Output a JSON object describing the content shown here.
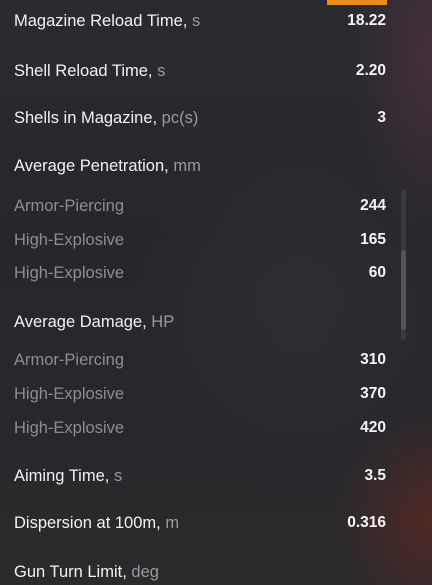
{
  "accent_color": "#ec8a1c",
  "stats": {
    "magazine_reload": {
      "label": "Magazine Reload Time,",
      "unit": "s",
      "value": "18.22"
    },
    "shell_reload": {
      "label": "Shell Reload Time,",
      "unit": "s",
      "value": "2.20"
    },
    "shells_in_magazine": {
      "label": "Shells in Magazine,",
      "unit": "pc(s)",
      "value": "3"
    },
    "avg_penetration": {
      "label": "Average Penetration,",
      "unit": "mm",
      "items": [
        {
          "label": "Armor-Piercing",
          "value": "244"
        },
        {
          "label": "High-Explosive",
          "value": "165"
        },
        {
          "label": "High-Explosive",
          "value": "60"
        }
      ]
    },
    "avg_damage": {
      "label": "Average Damage,",
      "unit": "HP",
      "items": [
        {
          "label": "Armor-Piercing",
          "value": "310"
        },
        {
          "label": "High-Explosive",
          "value": "370"
        },
        {
          "label": "High-Explosive",
          "value": "420"
        }
      ]
    },
    "aiming_time": {
      "label": "Aiming Time,",
      "unit": "s",
      "value": "3.5"
    },
    "dispersion": {
      "label": "Dispersion at 100m,",
      "unit": "m",
      "value": "0.316"
    },
    "gun_turn_limit": {
      "label": "Gun Turn Limit,",
      "unit": "deg"
    }
  }
}
